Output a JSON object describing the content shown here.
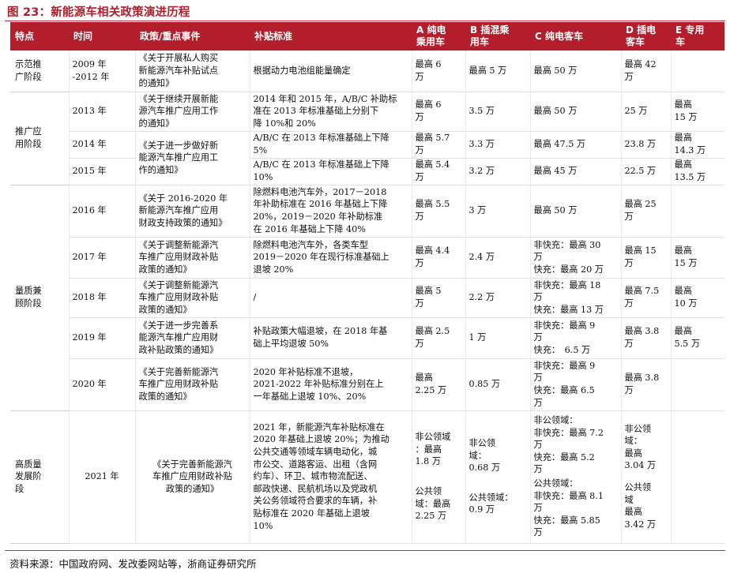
{
  "figure": {
    "title": "图 23：新能源车相关政策演进历程",
    "source": "资料来源：中国政府网、发改委网站等，浙商证券研究所"
  },
  "header": {
    "stage": "特点",
    "time": "时间",
    "policy": "政策/重点事件",
    "subsidy": "补贴标准",
    "a": "A 纯电\n乘用车",
    "b": "B 插混乘\n用车",
    "c": "C 纯电客车",
    "d": "D 插电\n客车",
    "e": "E 专用\n车"
  },
  "stages": {
    "s1": "示范推\n广阶段",
    "s2": "推广应\n用阶段",
    "s3": "量质兼\n顾阶段",
    "s4": "高质量\n发展阶\n段"
  },
  "rows": {
    "r2009": {
      "time": "2009 年\n-2012 年",
      "policy": "《关于开展私人购买\n新能源汽车补贴试点\n的通知》",
      "subsidy": "根据动力电池组能量确定",
      "a": "最高 6\n万",
      "b": "最高 5 万",
      "c": "最高 50 万",
      "d": "最高 42\n万",
      "e": ""
    },
    "r2013": {
      "time": "2013 年",
      "policy": "《关于继续开展新能\n源汽车推广应用工作\n的通知》",
      "subsidy": "2014 年和 2015 年，A/B/C 补助标\n准在 2013 年标准基础上分别下\n降 10%和 20%",
      "a": "最高 6\n万",
      "b": "3.5 万",
      "c": "最高 50 万",
      "d": "25 万",
      "e": "最高\n15 万"
    },
    "r2014": {
      "time": "2014 年",
      "policy": "《关于进一步做好新\n能源汽车推广应用工\n作的通知》",
      "subsidy": "A/B/C 在 2013 年标准基础上下降\n5%",
      "a": "最高 5.7\n万",
      "b": "3.3 万",
      "c": "最高 47.5 万",
      "d": "23.8 万",
      "e": "最高\n14.3 万"
    },
    "r2015": {
      "time": "2015 年",
      "subsidy": "A/B/C 在 2013 年标准基础上下降\n10%",
      "a": "最高 5.4\n万",
      "b": "3.2 万",
      "c": "最高 45 万",
      "d": "22.5 万",
      "e": "最高\n13.5 万"
    },
    "r2016": {
      "time": "2016 年",
      "policy": "《关于 2016-2020 年\n新能源汽车推广应用\n财政支持政策的通知》",
      "subsidy": "除燃料电池汽车外，2017－2018\n年补助标准在 2016 年基础上下降\n20%，2019－2020 年补助标准\n在 2016 年基础上下降 40%",
      "a": "最高 5.5\n万",
      "b": "3 万",
      "c": "最高 50 万",
      "d": "最高 25\n万",
      "e": ""
    },
    "r2017": {
      "time": "2017 年",
      "policy": "《关于调整新能源汽\n车推广应用财政补贴\n政策的通知》",
      "subsidy": "除燃料电池汽车外，各类车型\n2019－2020 年在现行标准基础上\n退坡 20%",
      "a": "最高 4.4\n万",
      "b": "2.4 万",
      "c": "非快充：最高 30\n万\n快充：最高 20 万",
      "d": "最高 15\n万",
      "e": "最高\n15 万"
    },
    "r2018": {
      "time": "2018 年",
      "policy": "《关于调整新能源汽\n车推广应用财政补贴\n政策的通知》",
      "subsidy": "/",
      "a": "最高 5\n万",
      "b": "2.2 万",
      "c": "非快充：最高 18\n万\n快充：最高 13 万",
      "d": "最高 7.5\n万",
      "e": "最高\n10 万"
    },
    "r2019": {
      "time": "2019 年",
      "policy": "《关于进一步完善系\n能源汽车推广应用财\n政补贴政策的通知》",
      "subsidy": "补贴政策大幅退坡，在 2018 年基\n础上平均退坡 50%",
      "a": "最高 2.5\n万",
      "b": "1 万",
      "c": "非快充：最高 9\n万\n快充：　6.5 万",
      "d": "最高 3.8\n万",
      "e": "最高\n5.5 万"
    },
    "r2020": {
      "time": "2020 年",
      "policy": "《关于完善新能源汽\n车推广应用财政补贴\n政策的通知》",
      "subsidy": "2020 年补贴标准不退坡，\n2021-2022 年补贴标准分别在上\n一年基础上退坡 10%、20%",
      "a": "最高\n2.25 万",
      "b": "0.85 万",
      "c": "非快充：最高 9\n万\n快充：最高 6.5\n万",
      "d": "最高 3.8\n万",
      "e": ""
    },
    "r2021": {
      "time": "2021 年",
      "policy": "《关于完善新能源汽\n车推广应用财政补贴\n政策的通知》",
      "subsidy": "2021 年，新能源汽车补贴标准在\n2020 年基础上退坡 20%；为推动\n公共交通等领域车辆电动化，城\n市公交、道路客运、出租（含网\n约车）、环卫、城市物流配送、\n邮政快递、民航机场以及党政机\n关公务领域符合要求的车辆，补\n贴标准在 2020 年基础上退坡\n10%",
      "a1": "非公领域\n：最高\n1.8 万",
      "a2": "公共领\n域：最高\n2.25 万",
      "b1": "非公领\n域：\n0.68 万",
      "b2": "公共领域：\n0.9 万",
      "c1": "非公领域：\n非快充：最高 7.2\n万\n快充：最高 5.2\n万",
      "c2": "公共领域：\n非快充：最高 8.1\n万\n快充：最高 5.85\n万",
      "d1": "非公领\n域：\n最高\n3.04 万",
      "d2": "公共领\n域\n最高\n3.42 万",
      "e": ""
    }
  }
}
